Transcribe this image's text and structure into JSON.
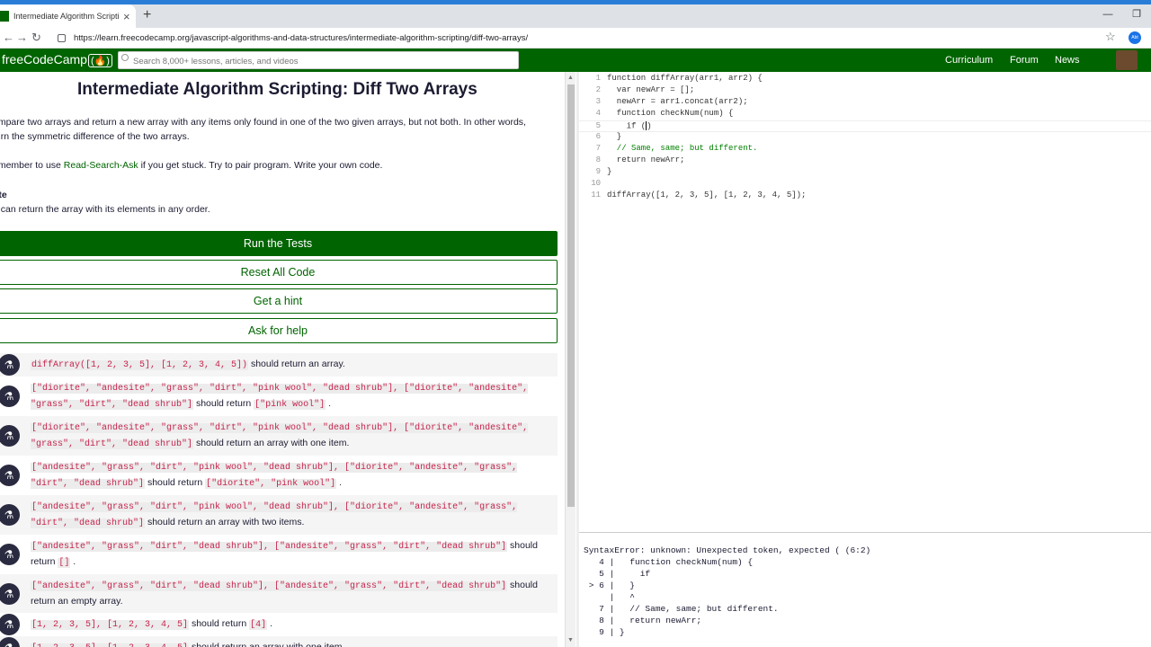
{
  "browser": {
    "tab_title": "Intermediate Algorithm Scripting",
    "url": "https://learn.freecodecamp.org/javascript-algorithms-and-data-structures/intermediate-algorithm-scripting/diff-two-arrays/"
  },
  "nav": {
    "logo": "freeCodeCamp",
    "logo_flame": "(🔥)",
    "search_placeholder": "Search 8,000+ lessons, articles, and videos",
    "links": [
      "Curriculum",
      "Forum",
      "News"
    ]
  },
  "challenge": {
    "title": "Intermediate Algorithm Scripting: Diff Two Arrays",
    "desc_line1": "ompare two arrays and return a new array with any items only found in one of the two given arrays, but not both. In other words,",
    "desc_line2": "turn the symmetric difference of the two arrays.",
    "remember_pre": "emember to use ",
    "remember_link": "Read-Search-Ask",
    "remember_post": " if you get stuck. Try to pair program. Write your own code.",
    "note_title": "ote",
    "note_text": "u can return the array with its elements in any order."
  },
  "buttons": {
    "run": "Run the Tests",
    "reset": "Reset All Code",
    "hint": "Get a hint",
    "help": "Ask for help"
  },
  "tests": [
    {
      "code": "diffArray([1, 2, 3, 5], [1, 2, 3, 4, 5])",
      "text": " should return an array."
    },
    {
      "code": "[\"diorite\", \"andesite\", \"grass\", \"dirt\", \"pink wool\", \"dead shrub\"], [\"diorite\", \"andesite\", \"grass\", \"dirt\", \"dead shrub\"]",
      "text": " should return ",
      "code2": "[\"pink wool\"]",
      "text2": " ."
    },
    {
      "code": "[\"diorite\", \"andesite\", \"grass\", \"dirt\", \"pink wool\", \"dead shrub\"], [\"diorite\", \"andesite\", \"grass\", \"dirt\", \"dead shrub\"]",
      "text": " should return an array with one item."
    },
    {
      "code": "[\"andesite\", \"grass\", \"dirt\", \"pink wool\", \"dead shrub\"], [\"diorite\", \"andesite\", \"grass\", \"dirt\", \"dead shrub\"]",
      "text": " should return ",
      "code2": "[\"diorite\", \"pink wool\"]",
      "text2": " ."
    },
    {
      "code": "[\"andesite\", \"grass\", \"dirt\", \"pink wool\", \"dead shrub\"], [\"diorite\", \"andesite\", \"grass\", \"dirt\", \"dead shrub\"]",
      "text": " should return an array with two items."
    },
    {
      "code": "[\"andesite\", \"grass\", \"dirt\", \"dead shrub\"], [\"andesite\", \"grass\", \"dirt\", \"dead shrub\"]",
      "text": " should return ",
      "code2": "[]",
      "text2": " ."
    },
    {
      "code": "[\"andesite\", \"grass\", \"dirt\", \"dead shrub\"], [\"andesite\", \"grass\", \"dirt\", \"dead shrub\"]",
      "text": " should return an empty array."
    },
    {
      "code": "[1, 2, 3, 5], [1, 2, 3, 4, 5]",
      "text": " should return ",
      "code2": "[4]",
      "text2": " ."
    },
    {
      "code": "[1, 2, 3, 5], [1, 2, 3, 4, 5]",
      "text": " should return an array with one item."
    }
  ],
  "editor": {
    "lines": [
      {
        "n": "1",
        "code": "function diffArray(arr1, arr2) {"
      },
      {
        "n": "2",
        "code": "  var newArr = [];"
      },
      {
        "n": "3",
        "code": "  newArr = arr1.concat(arr2);"
      },
      {
        "n": "4",
        "code": "  function checkNum(num) {"
      },
      {
        "n": "5",
        "code": "    if (",
        "after_cursor": ")"
      },
      {
        "n": "6",
        "code": "  }"
      },
      {
        "n": "7",
        "code": "  // Same, same; but different.",
        "comment": true
      },
      {
        "n": "8",
        "code": "  return newArr;"
      },
      {
        "n": "9",
        "code": "}"
      },
      {
        "n": "10",
        "code": ""
      },
      {
        "n": "11",
        "code": "diffArray([1, 2, 3, 5], [1, 2, 3, 4, 5]);"
      }
    ]
  },
  "console": {
    "lines": [
      "SyntaxError: unknown: Unexpected token, expected ( (6:2)",
      "   4 |   function checkNum(num) {",
      "   5 |     if",
      " > 6 |   }",
      "     |   ^",
      "   7 |   // Same, same; but different.",
      "   8 |   return newArr;",
      "   9 | }"
    ]
  }
}
